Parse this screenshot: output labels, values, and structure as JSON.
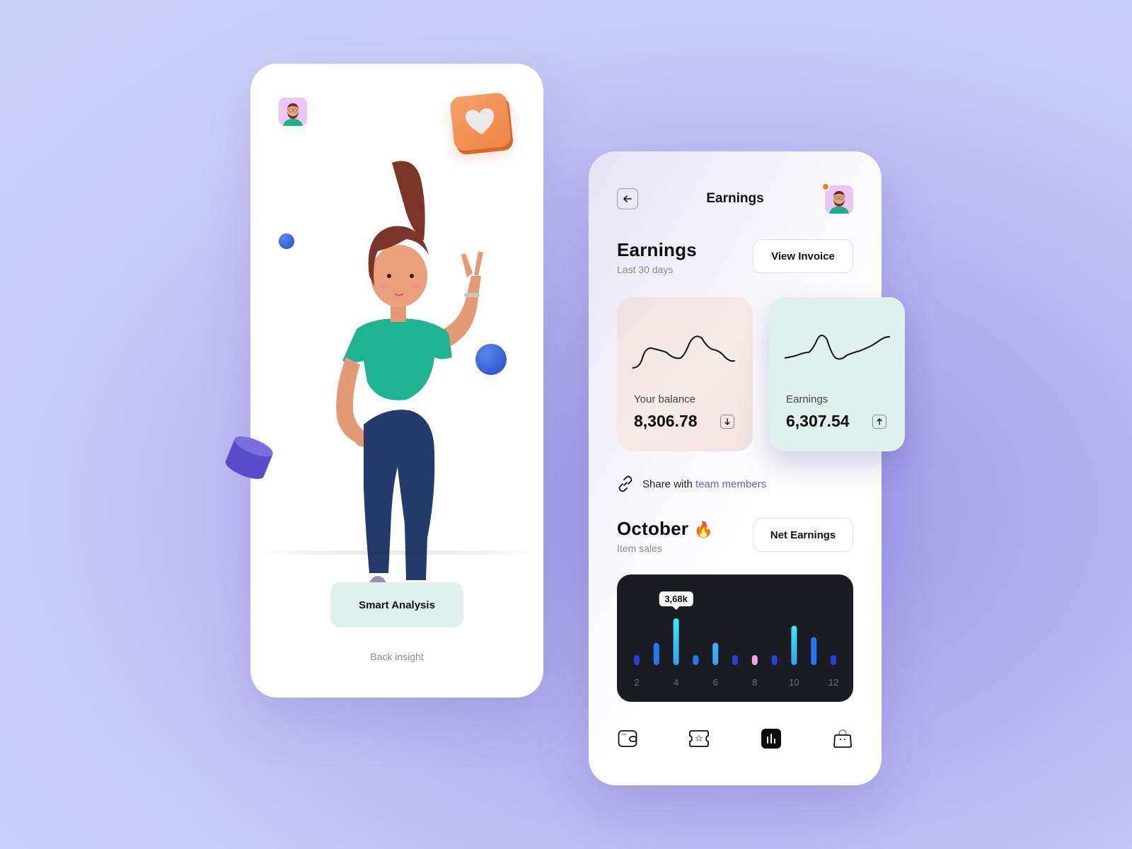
{
  "left_screen": {
    "smart_analysis_label": "Smart Analysis",
    "back_insight_label": "Back insight",
    "icons": [
      "user-avatar",
      "heart-icon",
      "sphere",
      "cylinder",
      "3d-character"
    ]
  },
  "right_screen": {
    "topbar": {
      "title": "Earnings",
      "notification": true
    },
    "earnings_section": {
      "title": "Earnings",
      "subtitle": "Last 30 days",
      "view_invoice_label": "View Invoice"
    },
    "cards": [
      {
        "label": "Your balance",
        "value": "8,306.78",
        "trend": "down",
        "bg": "#f3e6e4"
      },
      {
        "label": "Earnings",
        "value": "6,307.54",
        "trend": "up",
        "bg": "#dff1ed"
      }
    ],
    "share": {
      "prefix": "Share with",
      "link": "team members",
      "link_color": "#6c5ce7"
    },
    "october_section": {
      "title": "October",
      "emoji": "🔥",
      "subtitle": "Item sales",
      "net_earnings_label": "Net Earnings"
    },
    "bottom_nav": [
      {
        "name": "wallet",
        "active": false
      },
      {
        "name": "ticket",
        "active": false
      },
      {
        "name": "stats",
        "active": true
      },
      {
        "name": "bag",
        "active": false
      }
    ]
  },
  "chart_data": {
    "type": "bar",
    "title": "Item sales",
    "x": [
      2,
      3,
      4,
      5,
      6,
      7,
      8,
      9,
      10,
      11,
      12
    ],
    "tick_labels": [
      "2",
      "4",
      "6",
      "8",
      "10",
      "12"
    ],
    "values": [
      0.75,
      1.75,
      3.68,
      0.75,
      1.75,
      0.75,
      0.5,
      0.5,
      3.1,
      2.2,
      0.5
    ],
    "colors": [
      "#2a3ee0",
      "#2477ef",
      "#3ae9f2",
      "#2477ef",
      "#3cb6f4",
      "#2a3ee0",
      "#f3a5ec",
      "#2a3ee0",
      "#3ae9f2",
      "#2477ef",
      "#2a3ee0"
    ],
    "highlight_index": 2,
    "highlight_label": "3,68k",
    "ylim": [
      0,
      4
    ],
    "ylabel": "",
    "xlabel": ""
  }
}
